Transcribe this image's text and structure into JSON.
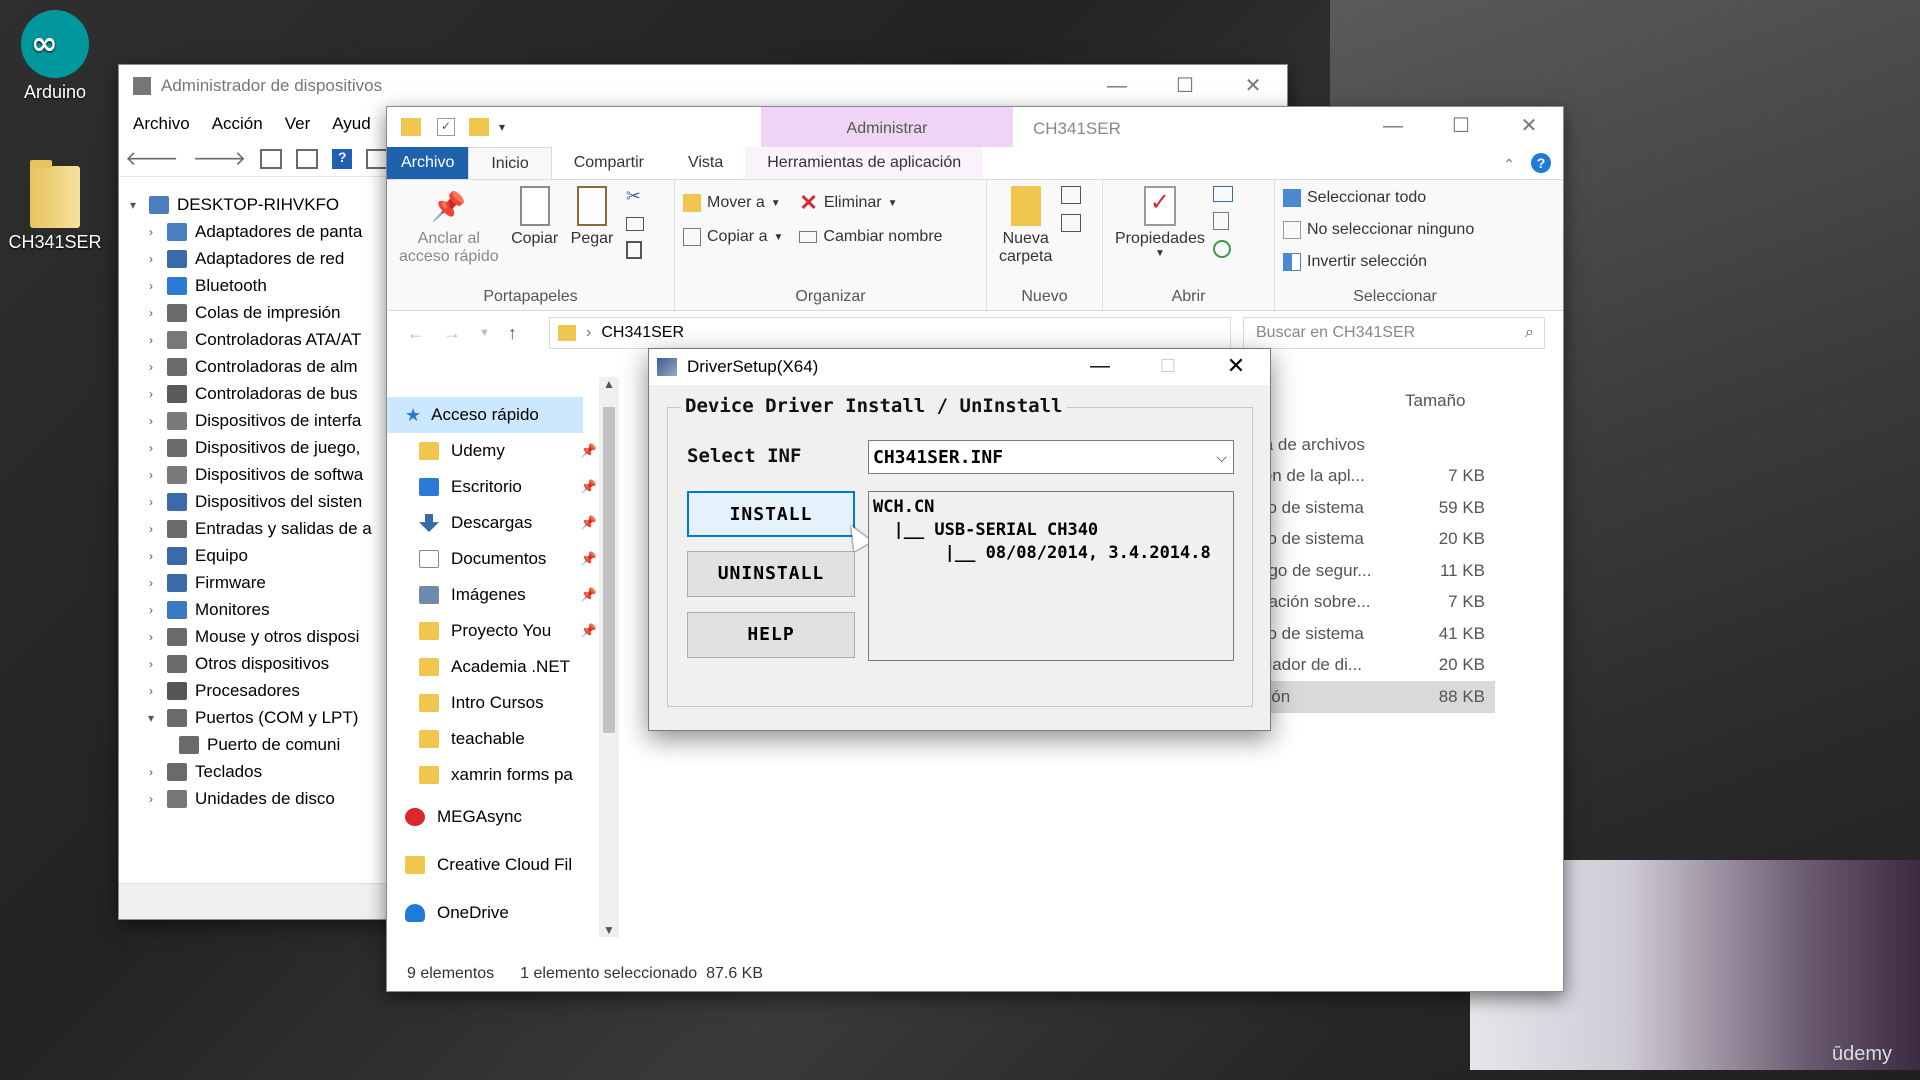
{
  "desktop": {
    "icons": [
      {
        "label": "Arduino",
        "icon": "arduino-icon"
      },
      {
        "label": "CH341SER",
        "icon": "folder-icon"
      }
    ],
    "watermark": "ūdemy"
  },
  "device_manager": {
    "title": "Administrador de dispositivos",
    "menu": [
      "Archivo",
      "Acción",
      "Ver",
      "Ayud"
    ],
    "root": "DESKTOP-RIHVKFO",
    "tree": [
      {
        "label": "Adaptadores de panta",
        "icon": "display-adapter-icon"
      },
      {
        "label": "Adaptadores de red",
        "icon": "network-adapter-icon"
      },
      {
        "label": "Bluetooth",
        "icon": "bluetooth-icon"
      },
      {
        "label": "Colas de impresión",
        "icon": "printer-icon"
      },
      {
        "label": "Controladoras ATA/AT",
        "icon": "ata-controller-icon"
      },
      {
        "label": "Controladoras de alm",
        "icon": "storage-controller-icon"
      },
      {
        "label": "Controladoras de bus",
        "icon": "usb-icon"
      },
      {
        "label": "Dispositivos de interfa",
        "icon": "hid-icon"
      },
      {
        "label": "Dispositivos de juego,",
        "icon": "sound-icon"
      },
      {
        "label": "Dispositivos de softwa",
        "icon": "software-device-icon"
      },
      {
        "label": "Dispositivos del sisten",
        "icon": "system-device-icon"
      },
      {
        "label": "Entradas y salidas de a",
        "icon": "audio-io-icon"
      },
      {
        "label": "Equipo",
        "icon": "computer-icon"
      },
      {
        "label": "Firmware",
        "icon": "firmware-icon"
      },
      {
        "label": "Monitores",
        "icon": "monitor-icon"
      },
      {
        "label": "Mouse y otros disposi",
        "icon": "mouse-icon"
      },
      {
        "label": "Otros dispositivos",
        "icon": "unknown-device-icon"
      },
      {
        "label": "Procesadores",
        "icon": "processor-icon"
      },
      {
        "label": "Puertos (COM y LPT)",
        "icon": "port-icon",
        "expanded": true
      },
      {
        "label": "Puerto de comuni",
        "icon": "com-port-icon",
        "child": true
      },
      {
        "label": "Teclados",
        "icon": "keyboard-icon"
      },
      {
        "label": "Unidades de disco",
        "icon": "disk-drive-icon"
      }
    ]
  },
  "explorer": {
    "title": "CH341SER",
    "context_tab": "Administrar",
    "tabs": [
      "Archivo",
      "Inicio",
      "Compartir",
      "Vista",
      "Herramientas de aplicación"
    ],
    "ribbon": {
      "clipboard": {
        "pin_l1": "Anclar al",
        "pin_l2": "acceso rápido",
        "copy": "Copiar",
        "paste": "Pegar",
        "group": "Portapapeles"
      },
      "organize": {
        "move": "Mover a",
        "delete": "Eliminar",
        "copy_to": "Copiar a",
        "rename": "Cambiar nombre",
        "group": "Organizar"
      },
      "new": {
        "folder_l1": "Nueva",
        "folder_l2": "carpeta",
        "group": "Nuevo"
      },
      "open": {
        "properties": "Propiedades",
        "group": "Abrir"
      },
      "select": {
        "all": "Seleccionar todo",
        "none": "No seleccionar ninguno",
        "invert": "Invertir selección",
        "group": "Seleccionar"
      }
    },
    "address": {
      "path": "CH341SER",
      "search_placeholder": "Buscar en CH341SER"
    },
    "nav": {
      "quick_access": "Acceso rápido",
      "items": [
        {
          "label": "Udemy",
          "pinned": true,
          "icon": "folder-icon"
        },
        {
          "label": "Escritorio",
          "pinned": true,
          "icon": "desktop-icon"
        },
        {
          "label": "Descargas",
          "pinned": true,
          "icon": "download-icon"
        },
        {
          "label": "Documentos",
          "pinned": true,
          "icon": "documents-icon"
        },
        {
          "label": "Imágenes",
          "pinned": true,
          "icon": "pictures-icon"
        },
        {
          "label": "Proyecto You",
          "pinned": true,
          "icon": "folder-icon"
        },
        {
          "label": "Academia .NET",
          "pinned": false,
          "icon": "folder-icon"
        },
        {
          "label": "Intro Cursos",
          "pinned": false,
          "icon": "folder-icon"
        },
        {
          "label": "teachable",
          "pinned": false,
          "icon": "folder-icon"
        },
        {
          "label": "xamrin forms pa",
          "pinned": false,
          "icon": "folder-icon"
        }
      ],
      "roots": [
        {
          "label": "MEGAsync",
          "icon": "megasync-icon"
        },
        {
          "label": "Creative Cloud Fil",
          "icon": "creative-cloud-icon"
        },
        {
          "label": "OneDrive",
          "icon": "onedrive-icon"
        }
      ]
    },
    "files": {
      "size_header": "Tamaño",
      "rows": [
        {
          "type": "ta de archivos",
          "size": ""
        },
        {
          "type": "ión de la apl...",
          "size": "7 KB"
        },
        {
          "type": "vo de sistema",
          "size": "59 KB"
        },
        {
          "type": "vo de sistema",
          "size": "20 KB"
        },
        {
          "type": "ego de segur...",
          "size": "11 KB"
        },
        {
          "type": "nación sobre...",
          "size": "7 KB"
        },
        {
          "type": "vo de sistema",
          "size": "41 KB"
        },
        {
          "type": "olador de di...",
          "size": "20 KB"
        },
        {
          "type": "ción",
          "size": "88 KB",
          "selected": true
        }
      ]
    },
    "status": {
      "count": "9 elementos",
      "selection": "1 elemento seleccionado  87.6 KB"
    }
  },
  "driver_setup": {
    "title": "DriverSetup(X64)",
    "group_title": "Device Driver Install / UnInstall",
    "select_label": "Select INF",
    "select_value": "CH341SER.INF",
    "buttons": {
      "install": "INSTALL",
      "uninstall": "UNINSTALL",
      "help": "HELP"
    },
    "info": {
      "line1": "WCH.CN",
      "line2": "  |__ USB-SERIAL CH340",
      "line3": "       |__ 08/08/2014, 3.4.2014.8"
    }
  }
}
